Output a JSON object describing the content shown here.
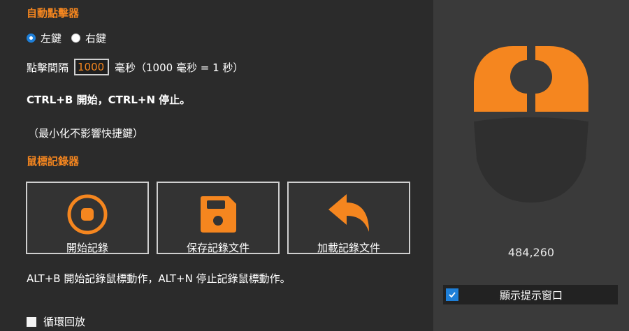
{
  "clicker": {
    "title": "自動點擊器",
    "radio": [
      {
        "label": "左鍵",
        "selected": true
      },
      {
        "label": "右鍵",
        "selected": false
      }
    ],
    "interval_label": "點擊間隔",
    "interval_value": "1000",
    "interval_unit": "毫秒（1000 毫秒 = 1 秒）",
    "hotkey_text": "CTRL+B 開始，CTRL+N 停止。",
    "note": "（最小化不影響快捷鍵）"
  },
  "recorder": {
    "title": "鼠標記錄器",
    "buttons": [
      {
        "label": "開始記錄",
        "icon": "record-icon"
      },
      {
        "label": "保存記錄文件",
        "icon": "save-icon"
      },
      {
        "label": "加載記錄文件",
        "icon": "undo-arrow-icon"
      }
    ],
    "hotkey_text": "ALT+B 開始記錄鼠標動作，ALT+N 停止記錄鼠標動作。",
    "loop_label": "循環回放",
    "loop_checked": false
  },
  "status": {
    "coordinates": "484,260",
    "show_tip_label": "顯示提示窗口",
    "show_tip_checked": true
  },
  "colors": {
    "accent": "#f5861f",
    "checkbox": "#1e7fd8",
    "mouse_body": "#2f2f2f"
  }
}
